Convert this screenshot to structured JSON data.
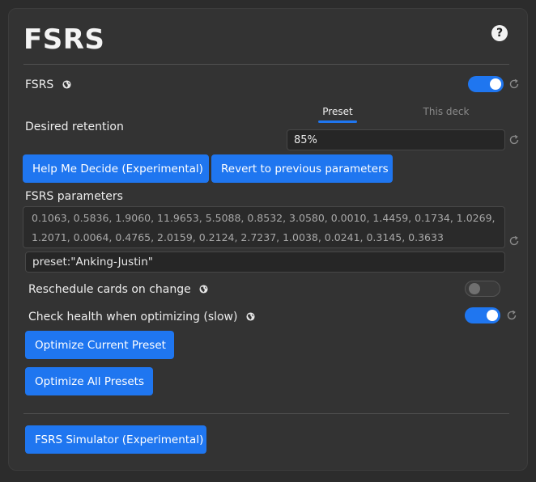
{
  "header": {
    "title": "FSRS",
    "help_icon_glyph": "?"
  },
  "fsrs_toggle": {
    "label": "FSRS",
    "enabled": true
  },
  "tabs": [
    {
      "label": "Preset",
      "active": true
    },
    {
      "label": "This deck",
      "active": false
    }
  ],
  "desired_retention": {
    "label": "Desired retention",
    "value": "85%"
  },
  "buttons": {
    "help_me_decide": "Help Me Decide (Experimental)",
    "revert": "Revert to previous parameters",
    "optimize_current": "Optimize Current Preset",
    "optimize_all": "Optimize All Presets",
    "simulator": "FSRS Simulator (Experimental)"
  },
  "fsrs_parameters": {
    "label": "FSRS parameters",
    "line1": "0.1063, 0.5836, 1.9060, 11.9653, 5.5088, 0.8532, 3.0580, 0.0010, 1.4459, 0.1734, 1.0269,",
    "line2": "1.2071, 0.0064, 0.4765, 2.0159, 0.2124, 2.7237, 1.0038, 0.0241, 0.3145, 0.3633"
  },
  "search_query": {
    "value": "preset:\"Anking-Justin\""
  },
  "reschedule": {
    "label": "Reschedule cards on change",
    "enabled": false
  },
  "check_health": {
    "label": "Check health when optimizing (slow)",
    "enabled": true
  },
  "colors": {
    "accent": "#1f76f0",
    "panel": "#333333",
    "background": "#2c2c2c"
  }
}
